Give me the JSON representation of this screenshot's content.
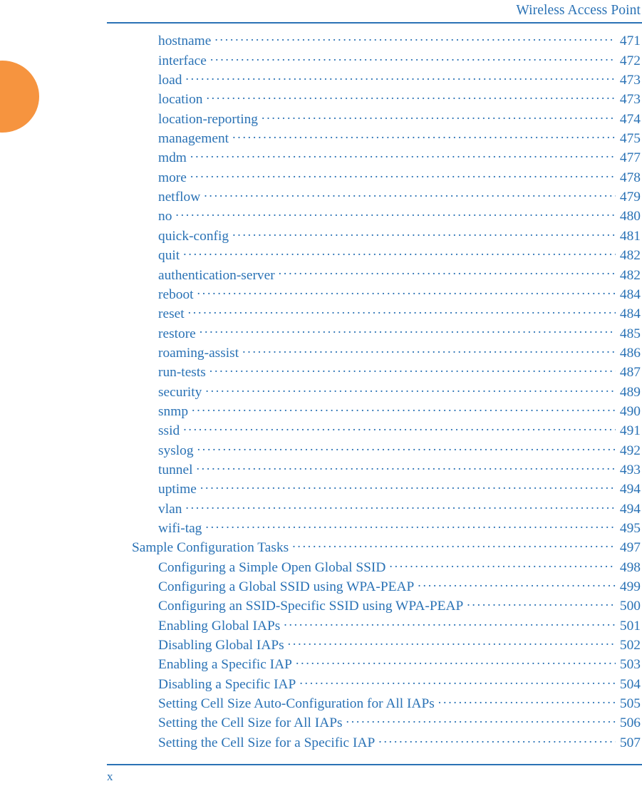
{
  "header": {
    "title": "Wireless Access Point"
  },
  "footer": {
    "page_number": "x"
  },
  "colors": {
    "text_blue": "#2a72b5",
    "rule_blue": "#2a72b5",
    "thumb_tab_orange": "#f6943f",
    "background": "#ffffff"
  },
  "toc": {
    "entries": [
      {
        "label": "hostname",
        "page": "471",
        "level": 2
      },
      {
        "label": "interface",
        "page": "472",
        "level": 2
      },
      {
        "label": "load",
        "page": "473",
        "level": 2
      },
      {
        "label": "location",
        "page": "473",
        "level": 2
      },
      {
        "label": "location-reporting",
        "page": "474",
        "level": 2
      },
      {
        "label": "management",
        "page": "475",
        "level": 2
      },
      {
        "label": "mdm",
        "page": "477",
        "level": 2
      },
      {
        "label": "more",
        "page": "478",
        "level": 2
      },
      {
        "label": "netflow",
        "page": "479",
        "level": 2
      },
      {
        "label": "no",
        "page": "480",
        "level": 2
      },
      {
        "label": "quick-config",
        "page": "481",
        "level": 2
      },
      {
        "label": "quit",
        "page": "482",
        "level": 2
      },
      {
        "label": "authentication-server",
        "page": "482",
        "level": 2
      },
      {
        "label": "reboot",
        "page": "484",
        "level": 2
      },
      {
        "label": "reset",
        "page": "484",
        "level": 2
      },
      {
        "label": "restore",
        "page": "485",
        "level": 2
      },
      {
        "label": "roaming-assist",
        "page": "486",
        "level": 2
      },
      {
        "label": "run-tests",
        "page": "487",
        "level": 2
      },
      {
        "label": "security",
        "page": "489",
        "level": 2
      },
      {
        "label": "snmp",
        "page": "490",
        "level": 2
      },
      {
        "label": "ssid",
        "page": "491",
        "level": 2
      },
      {
        "label": "syslog",
        "page": "492",
        "level": 2
      },
      {
        "label": "tunnel",
        "page": "493",
        "level": 2
      },
      {
        "label": "uptime",
        "page": "494",
        "level": 2
      },
      {
        "label": "vlan",
        "page": "494",
        "level": 2
      },
      {
        "label": "wifi-tag",
        "page": "495",
        "level": 2
      },
      {
        "label": "Sample Configuration Tasks",
        "page": "497",
        "level": 1
      },
      {
        "label": "Configuring a Simple Open Global SSID",
        "page": "498",
        "level": 2
      },
      {
        "label": "Configuring a Global SSID using WPA-PEAP",
        "page": "499",
        "level": 2
      },
      {
        "label": "Configuring an SSID-Specific SSID using WPA-PEAP",
        "page": "500",
        "level": 2
      },
      {
        "label": "Enabling Global IAPs",
        "page": "501",
        "level": 2
      },
      {
        "label": "Disabling Global IAPs",
        "page": "502",
        "level": 2
      },
      {
        "label": "Enabling a Specific IAP",
        "page": "503",
        "level": 2
      },
      {
        "label": "Disabling a Specific IAP",
        "page": "504",
        "level": 2
      },
      {
        "label": "Setting Cell Size Auto-Configuration for All IAPs",
        "page": "505",
        "level": 2
      },
      {
        "label": "Setting the Cell Size for All IAPs",
        "page": "506",
        "level": 2
      },
      {
        "label": "Setting the Cell Size for a Specific IAP",
        "page": "507",
        "level": 2
      }
    ]
  }
}
